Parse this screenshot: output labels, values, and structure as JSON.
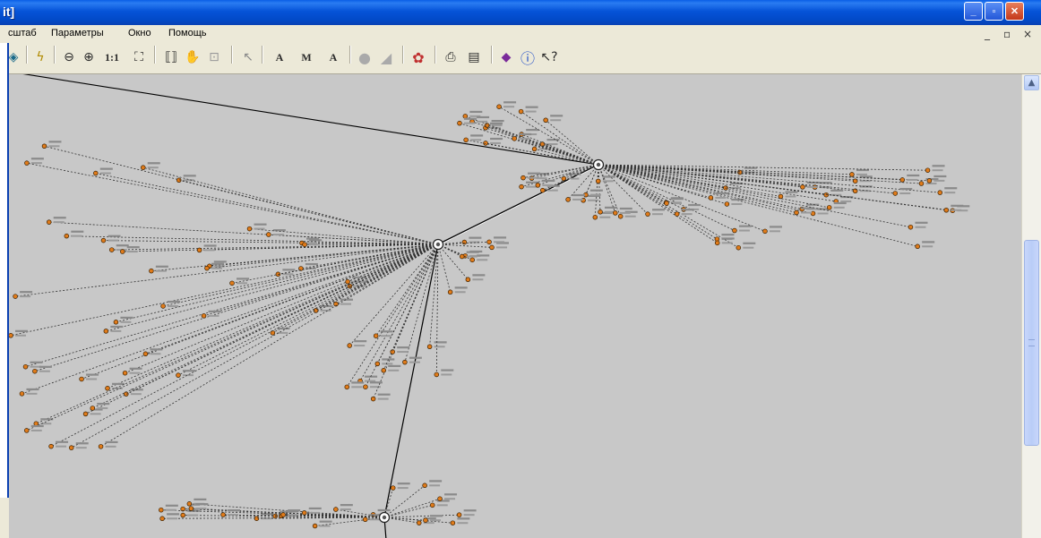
{
  "window": {
    "title_fragment": "it]",
    "controls": {
      "minimize": "_",
      "restore": "▫",
      "close": "✕"
    }
  },
  "menu": {
    "items": [
      "сштаб",
      "Параметры",
      "Окно",
      "Помощь"
    ],
    "mdi_controls": {
      "minimize": "_",
      "restore": "▫",
      "close": "×"
    }
  },
  "toolbar": {
    "one_to_one_label": "1:1",
    "text_tools": [
      "A",
      "M",
      "A"
    ]
  },
  "diagram": {
    "hubs": [
      {
        "id": "hub-upper-right",
        "label": ""
      },
      {
        "id": "hub-center",
        "label": ""
      },
      {
        "id": "hub-bottom",
        "label": ""
      }
    ],
    "node_color": "#e07b1a",
    "line_color": "#000000"
  }
}
